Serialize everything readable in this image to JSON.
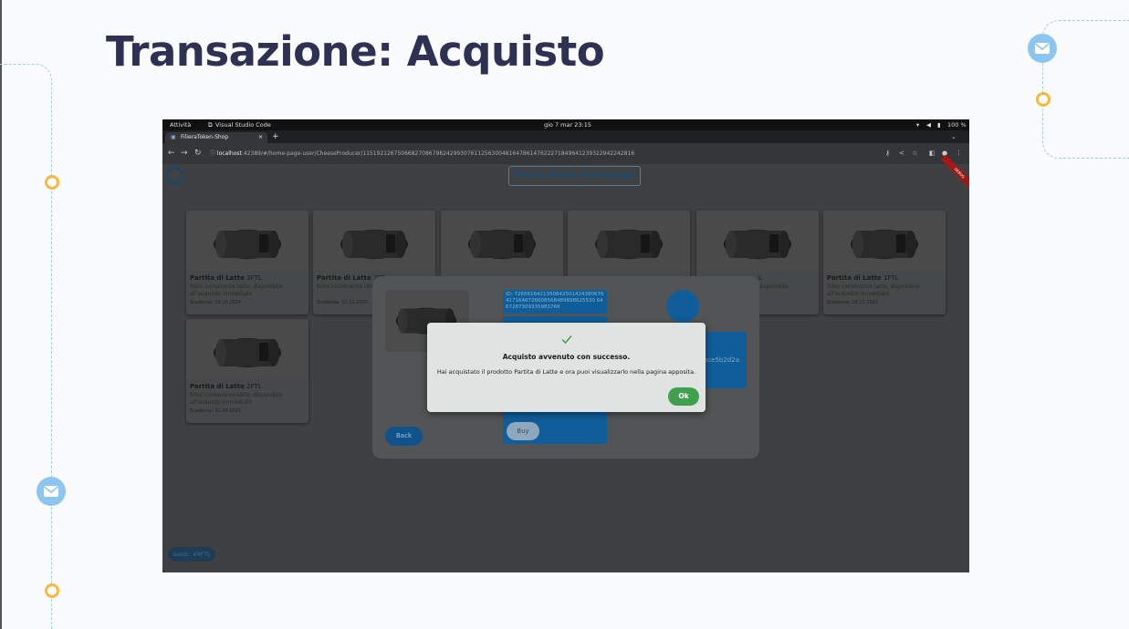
{
  "slide": {
    "title": "Transazione: Acquisto"
  },
  "os_bar": {
    "activities": "Attività",
    "app_name": "Visual Studio Code",
    "datetime": "gio 7 mar  23:15",
    "battery": "100 %"
  },
  "browser": {
    "tab_title": "FilieraToken-Shop",
    "tab_close": "×",
    "new_tab": "+",
    "url_host": "localhost",
    "url_rest": ":42389/#/home-page-user/CheeseProducer/115192126750668270867982429930761125630048164786147622271849641239322942242816"
  },
  "app": {
    "title": "Filiera-Token-Homepage",
    "debug_banner": "DEBUG",
    "balance": "Saldo: 49FTL",
    "cards": [
      {
        "name": "Partita di Latte",
        "price": "3FTL",
        "desc": "Silos contenente latte, disponibile all'acquisto immediato",
        "expiry": "Scadenza: 19.10.2024"
      },
      {
        "name": "Partita di Latte",
        "price": "2FT",
        "desc": "Silos contenente latt all'acquisto immedi",
        "expiry": "Scadenza: 11.11.2025"
      },
      {
        "name": "",
        "price": "",
        "desc": "",
        "expiry": ""
      },
      {
        "name": "",
        "price": "",
        "desc": "",
        "expiry": ""
      },
      {
        "name": "",
        "price": "L",
        "desc": "disponibile",
        "expiry": ""
      },
      {
        "name": "Partita di Latte",
        "price": "1FTL",
        "desc": "Silos contenente latte, disponibile all'acquisto immediato",
        "expiry": "Scadenza: 18.11.2025"
      },
      {
        "name": "Partita di Latte",
        "price": "2FTL",
        "desc": "Silos contenente latte, disponibile all'acquisto immediato",
        "expiry": "Scadenza: 20.04.2025"
      }
    ],
    "detail": {
      "id_text": "ID: 72656164213506425014243806764171646726608568489898625530 6467287309335983768",
      "owner": "ace5b2d2a",
      "back_label": "Back",
      "buy_label": "Buy"
    },
    "dialog": {
      "title": "Acquisto avvenuto con successo.",
      "message": "Hai acquistato il prodotto Partita di Latte e ora puoi visualizzarlo nella pagina apposita.",
      "ok_label": "Ok"
    }
  }
}
